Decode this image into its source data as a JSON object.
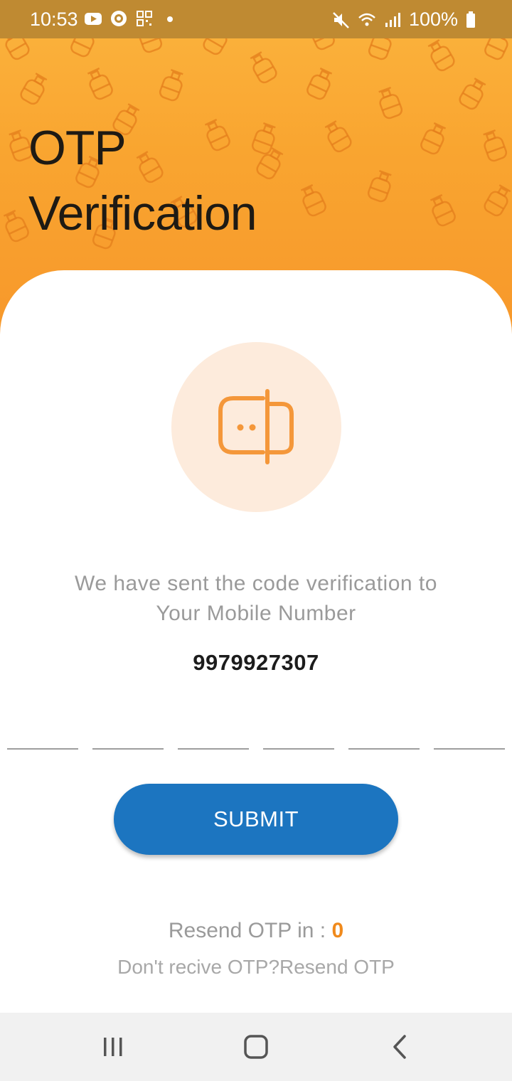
{
  "status_bar": {
    "time": "10:53",
    "battery": "100%",
    "left_icons": [
      "youtube-icon",
      "camera-app-icon",
      "qr-icon",
      "dot-icon"
    ],
    "right_icons": [
      "mute-icon",
      "wifi-icon",
      "signal-icon",
      "battery-icon"
    ]
  },
  "header": {
    "title_line1": "OTP",
    "title_line2": "Verification",
    "background_color": "#f9a530",
    "pattern_icon": "gas-cylinder-icon"
  },
  "otp_icon": "message-dots-icon",
  "message": {
    "line1": "We have sent the code verification to",
    "line2": "Your Mobile Number"
  },
  "phone_number": "9979927307",
  "otp_inputs": [
    "",
    "",
    "",
    "",
    "",
    ""
  ],
  "submit_label": "SUBMIT",
  "resend": {
    "timer_label": "Resend OTP in : ",
    "timer_value": "0",
    "link_text": "Don't recive OTP?Resend OTP"
  },
  "colors": {
    "accent": "#f08a1c",
    "primary_button": "#1c75c0",
    "status_bar": "#bf8a32"
  },
  "nav_bar": [
    "recents-icon",
    "home-icon",
    "back-icon"
  ]
}
